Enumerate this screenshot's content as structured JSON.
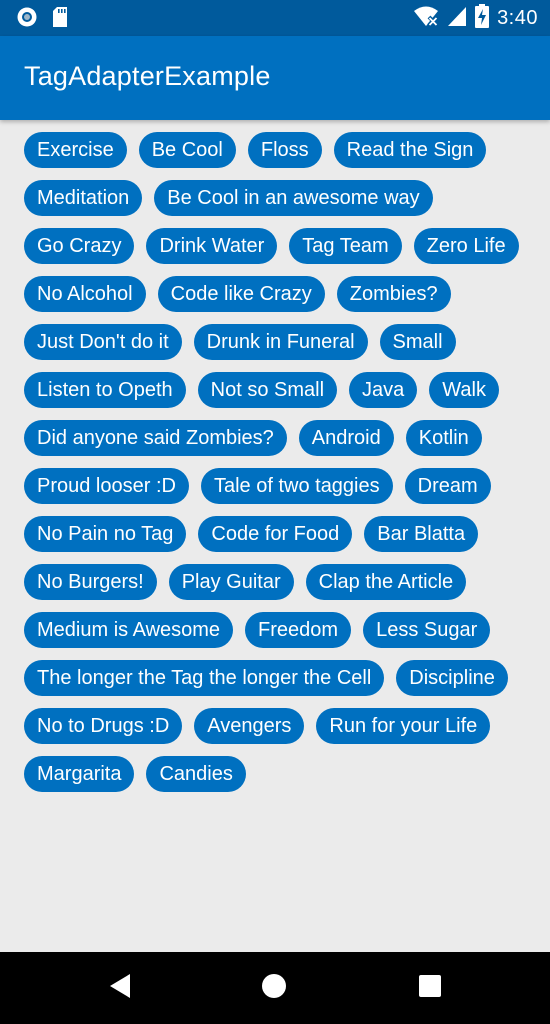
{
  "status_bar": {
    "time": "3:40",
    "icons": [
      "circle-notification-icon",
      "sd-card-icon",
      "wifi-off-icon",
      "cell-signal-icon",
      "battery-charging-icon"
    ]
  },
  "app_bar": {
    "title": "TagAdapterExample"
  },
  "tags": [
    "Exercise",
    "Be Cool",
    "Floss",
    "Read the Sign",
    "Meditation",
    "Be Cool in an awesome way",
    "Go Crazy",
    "Drink Water",
    "Tag Team",
    "Zero Life",
    "No Alcohol",
    "Code like Crazy",
    "Zombies?",
    "Just Don't do it",
    "Drunk in Funeral",
    "Small",
    "Listen to Opeth",
    "Not so Small",
    "Java",
    "Walk",
    "Did anyone said Zombies?",
    "Android",
    "Kotlin",
    "Proud looser :D",
    "Tale of two taggies",
    "Dream",
    "No Pain no Tag",
    "Code for Food",
    "Bar Blatta",
    "No Burgers!",
    "Play Guitar",
    "Clap the Article",
    "Medium is Awesome",
    "Freedom",
    "Less Sugar",
    "The longer the Tag the longer the Cell",
    "Discipline",
    "No to Drugs :D",
    "Avengers",
    "Run for your Life",
    "Margarita",
    "Candies"
  ],
  "colors": {
    "status_bar": "#005a9c",
    "app_bar": "#0070c0",
    "tag_background": "#0070c0",
    "tag_text": "#ffffff",
    "page_background": "#ebebeb",
    "nav_bar": "#000000"
  },
  "nav_bar": {
    "buttons": [
      "back-icon",
      "home-icon",
      "recents-icon"
    ]
  }
}
